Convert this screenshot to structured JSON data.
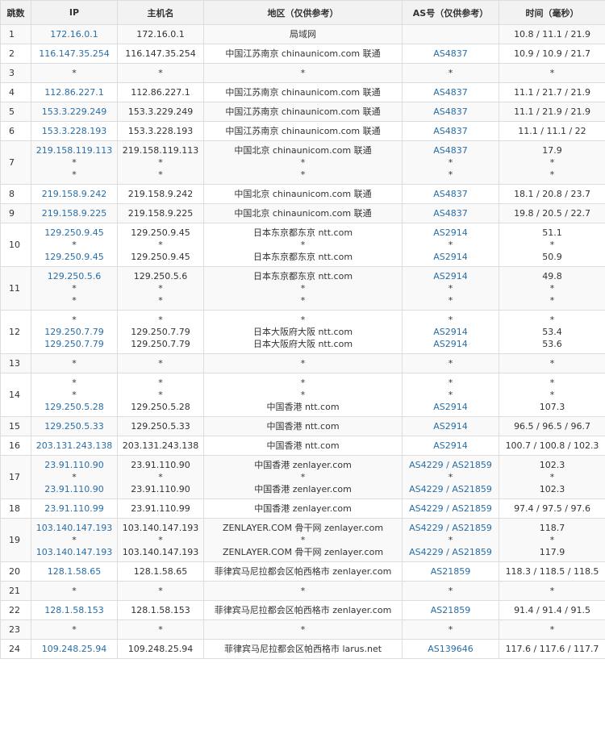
{
  "header": {
    "hop": "跳数",
    "ip": "IP",
    "host": "主机名",
    "region": "地区（仅供参考）",
    "as": "AS号（仅供参考）",
    "time": "时间（毫秒）"
  },
  "rows": [
    {
      "hop": "1",
      "ip": [
        "172.16.0.1"
      ],
      "host": [
        "172.16.0.1"
      ],
      "region": [
        "局域网"
      ],
      "as": [
        ""
      ],
      "time": [
        "10.8 / 11.1 / 21.9"
      ]
    },
    {
      "hop": "2",
      "ip": [
        "116.147.35.254"
      ],
      "host": [
        "116.147.35.254"
      ],
      "region": [
        "中国江苏南京 chinaunicom.com 联通"
      ],
      "as": [
        "AS4837"
      ],
      "time": [
        "10.9 / 10.9 / 21.7"
      ]
    },
    {
      "hop": "3",
      "ip": [
        "*"
      ],
      "host": [
        "*"
      ],
      "region": [
        "*"
      ],
      "as": [
        "*"
      ],
      "time": [
        "*"
      ]
    },
    {
      "hop": "4",
      "ip": [
        "112.86.227.1"
      ],
      "host": [
        "112.86.227.1"
      ],
      "region": [
        "中国江苏南京 chinaunicom.com 联通"
      ],
      "as": [
        "AS4837"
      ],
      "time": [
        "11.1 / 21.7 / 21.9"
      ]
    },
    {
      "hop": "5",
      "ip": [
        "153.3.229.249"
      ],
      "host": [
        "153.3.229.249"
      ],
      "region": [
        "中国江苏南京 chinaunicom.com 联通"
      ],
      "as": [
        "AS4837"
      ],
      "time": [
        "11.1 / 21.9 / 21.9"
      ]
    },
    {
      "hop": "6",
      "ip": [
        "153.3.228.193"
      ],
      "host": [
        "153.3.228.193"
      ],
      "region": [
        "中国江苏南京 chinaunicom.com 联通"
      ],
      "as": [
        "AS4837"
      ],
      "time": [
        "11.1 / 11.1 / 22"
      ]
    },
    {
      "hop": "7",
      "ip": [
        "219.158.119.113",
        "*",
        "*"
      ],
      "host": [
        "219.158.119.113",
        "*",
        "*"
      ],
      "region": [
        "中国北京 chinaunicom.com 联通",
        "*",
        "*"
      ],
      "as": [
        "AS4837",
        "*",
        "*"
      ],
      "time": [
        "17.9",
        "*",
        "*"
      ]
    },
    {
      "hop": "8",
      "ip": [
        "219.158.9.242"
      ],
      "host": [
        "219.158.9.242"
      ],
      "region": [
        "中国北京 chinaunicom.com 联通"
      ],
      "as": [
        "AS4837"
      ],
      "time": [
        "18.1 / 20.8 / 23.7"
      ]
    },
    {
      "hop": "9",
      "ip": [
        "219.158.9.225"
      ],
      "host": [
        "219.158.9.225"
      ],
      "region": [
        "中国北京 chinaunicom.com 联通"
      ],
      "as": [
        "AS4837"
      ],
      "time": [
        "19.8 / 20.5 / 22.7"
      ]
    },
    {
      "hop": "10",
      "ip": [
        "129.250.9.45",
        "*",
        "129.250.9.45"
      ],
      "host": [
        "129.250.9.45",
        "*",
        "129.250.9.45"
      ],
      "region": [
        "日本东京都东京 ntt.com",
        "*",
        "日本东京都东京 ntt.com"
      ],
      "as": [
        "AS2914",
        "*",
        "AS2914"
      ],
      "time": [
        "51.1",
        "*",
        "50.9"
      ]
    },
    {
      "hop": "11",
      "ip": [
        "129.250.5.6",
        "*",
        "*"
      ],
      "host": [
        "129.250.5.6",
        "*",
        "*"
      ],
      "region": [
        "日本东京都东京 ntt.com",
        "*",
        "*"
      ],
      "as": [
        "AS2914",
        "*",
        "*"
      ],
      "time": [
        "49.8",
        "*",
        "*"
      ]
    },
    {
      "hop": "12",
      "ip": [
        "*",
        "129.250.7.79",
        "129.250.7.79"
      ],
      "host": [
        "*",
        "129.250.7.79",
        "129.250.7.79"
      ],
      "region": [
        "*",
        "日本大阪府大阪 ntt.com",
        "日本大阪府大阪 ntt.com"
      ],
      "as": [
        "*",
        "AS2914",
        "AS2914"
      ],
      "time": [
        "*",
        "53.4",
        "53.6"
      ]
    },
    {
      "hop": "13",
      "ip": [
        "*"
      ],
      "host": [
        "*"
      ],
      "region": [
        "*"
      ],
      "as": [
        "*"
      ],
      "time": [
        "*"
      ]
    },
    {
      "hop": "14",
      "ip": [
        "*",
        "*",
        "129.250.5.28"
      ],
      "host": [
        "*",
        "*",
        "129.250.5.28"
      ],
      "region": [
        "*",
        "*",
        "中国香港 ntt.com"
      ],
      "as": [
        "*",
        "*",
        "AS2914"
      ],
      "time": [
        "*",
        "*",
        "107.3"
      ]
    },
    {
      "hop": "15",
      "ip": [
        "129.250.5.33"
      ],
      "host": [
        "129.250.5.33"
      ],
      "region": [
        "中国香港 ntt.com"
      ],
      "as": [
        "AS2914"
      ],
      "time": [
        "96.5 / 96.5 / 96.7"
      ]
    },
    {
      "hop": "16",
      "ip": [
        "203.131.243.138"
      ],
      "host": [
        "203.131.243.138"
      ],
      "region": [
        "中国香港 ntt.com"
      ],
      "as": [
        "AS2914"
      ],
      "time": [
        "100.7 / 100.8 / 102.3"
      ]
    },
    {
      "hop": "17",
      "ip": [
        "23.91.110.90",
        "*",
        "23.91.110.90"
      ],
      "host": [
        "23.91.110.90",
        "*",
        "23.91.110.90"
      ],
      "region": [
        "中国香港 zenlayer.com",
        "*",
        "中国香港 zenlayer.com"
      ],
      "as": [
        "AS4229 / AS21859",
        "*",
        "AS4229 / AS21859"
      ],
      "time": [
        "102.3",
        "*",
        "102.3"
      ]
    },
    {
      "hop": "18",
      "ip": [
        "23.91.110.99"
      ],
      "host": [
        "23.91.110.99"
      ],
      "region": [
        "中国香港 zenlayer.com"
      ],
      "as": [
        "AS4229 / AS21859"
      ],
      "time": [
        "97.4 / 97.5 / 97.6"
      ]
    },
    {
      "hop": "19",
      "ip": [
        "103.140.147.193",
        "*",
        "103.140.147.193"
      ],
      "host": [
        "103.140.147.193",
        "*",
        "103.140.147.193"
      ],
      "region": [
        "ZENLAYER.COM 骨干网 zenlayer.com",
        "*",
        "ZENLAYER.COM 骨干网 zenlayer.com"
      ],
      "as": [
        "AS4229 / AS21859",
        "*",
        "AS4229 / AS21859"
      ],
      "time": [
        "118.7",
        "*",
        "117.9"
      ]
    },
    {
      "hop": "20",
      "ip": [
        "128.1.58.65"
      ],
      "host": [
        "128.1.58.65"
      ],
      "region": [
        "菲律宾马尼拉都会区帕西格市 zenlayer.com"
      ],
      "as": [
        "AS21859"
      ],
      "time": [
        "118.3 / 118.5 / 118.5"
      ]
    },
    {
      "hop": "21",
      "ip": [
        "*"
      ],
      "host": [
        "*"
      ],
      "region": [
        "*"
      ],
      "as": [
        "*"
      ],
      "time": [
        "*"
      ]
    },
    {
      "hop": "22",
      "ip": [
        "128.1.58.153"
      ],
      "host": [
        "128.1.58.153"
      ],
      "region": [
        "菲律宾马尼拉都会区帕西格市 zenlayer.com"
      ],
      "as": [
        "AS21859"
      ],
      "time": [
        "91.4 / 91.4 / 91.5"
      ]
    },
    {
      "hop": "23",
      "ip": [
        "*"
      ],
      "host": [
        "*"
      ],
      "region": [
        "*"
      ],
      "as": [
        "*"
      ],
      "time": [
        "*"
      ]
    },
    {
      "hop": "24",
      "ip": [
        "109.248.25.94"
      ],
      "host": [
        "109.248.25.94"
      ],
      "region": [
        "菲律宾马尼拉都会区帕西格市 larus.net"
      ],
      "as": [
        "AS139646"
      ],
      "time": [
        "117.6 / 117.6 / 117.7"
      ]
    }
  ]
}
